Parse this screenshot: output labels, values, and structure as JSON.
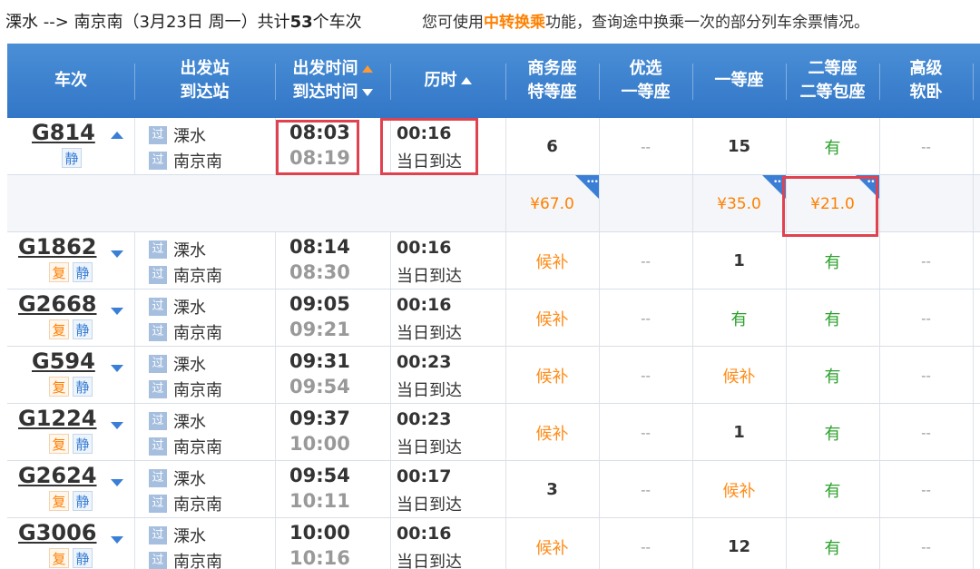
{
  "header": {
    "route_prefix": "溧水 --> 南京南（3月23日  周一）共计",
    "count": "53",
    "route_suffix": "个车次",
    "notice_prefix": "您可使用",
    "notice_link": "中转换乘",
    "notice_suffix": "功能，查询途中换乘一次的部分列车余票情况。"
  },
  "columns": {
    "train": "车次",
    "stations_1": "出发站",
    "stations_2": "到达站",
    "times_1": "出发时间",
    "times_2": "到达时间",
    "duration": "历时",
    "business_1": "商务座",
    "business_2": "特等座",
    "premium_1": "优选",
    "premium_2": "一等座",
    "first": "一等座",
    "second_1": "二等座",
    "second_2": "二等包座",
    "soft_1": "高级",
    "soft_2": "软卧"
  },
  "trains": [
    {
      "code": "G814",
      "fu": "",
      "jing": "静",
      "from_tag": "过",
      "from": "溧水",
      "to_tag": "过",
      "to": "南京南",
      "dep": "08:03",
      "arr": "08:19",
      "dur": "00:16",
      "arrday": "当日到达",
      "business": "6",
      "premium": "--",
      "first": "15",
      "second": "有",
      "soft": "--"
    },
    {
      "code": "G1862",
      "fu": "复",
      "jing": "静",
      "from_tag": "过",
      "from": "溧水",
      "to_tag": "过",
      "to": "南京南",
      "dep": "08:14",
      "arr": "08:30",
      "dur": "00:16",
      "arrday": "当日到达",
      "business": "候补",
      "premium": "--",
      "first": "1",
      "second": "有",
      "soft": "--"
    },
    {
      "code": "G2668",
      "fu": "复",
      "jing": "静",
      "from_tag": "过",
      "from": "溧水",
      "to_tag": "过",
      "to": "南京南",
      "dep": "09:05",
      "arr": "09:21",
      "dur": "00:16",
      "arrday": "当日到达",
      "business": "候补",
      "premium": "--",
      "first": "有",
      "second": "有",
      "soft": "--"
    },
    {
      "code": "G594",
      "fu": "复",
      "jing": "静",
      "from_tag": "过",
      "from": "溧水",
      "to_tag": "过",
      "to": "南京南",
      "dep": "09:31",
      "arr": "09:54",
      "dur": "00:23",
      "arrday": "当日到达",
      "business": "候补",
      "premium": "--",
      "first": "候补",
      "second": "有",
      "soft": "--"
    },
    {
      "code": "G1224",
      "fu": "复",
      "jing": "静",
      "from_tag": "过",
      "from": "溧水",
      "to_tag": "过",
      "to": "南京南",
      "dep": "09:37",
      "arr": "10:00",
      "dur": "00:23",
      "arrday": "当日到达",
      "business": "候补",
      "premium": "--",
      "first": "1",
      "second": "有",
      "soft": "--"
    },
    {
      "code": "G2624",
      "fu": "复",
      "jing": "静",
      "from_tag": "过",
      "from": "溧水",
      "to_tag": "过",
      "to": "南京南",
      "dep": "09:54",
      "arr": "10:11",
      "dur": "00:17",
      "arrday": "当日到达",
      "business": "3",
      "premium": "--",
      "first": "候补",
      "second": "有",
      "soft": "--"
    },
    {
      "code": "G3006",
      "fu": "复",
      "jing": "静",
      "from_tag": "过",
      "from": "溧水",
      "to_tag": "过",
      "to": "南京南",
      "dep": "10:00",
      "arr": "10:16",
      "dur": "00:16",
      "arrday": "当日到达",
      "business": "候补",
      "premium": "--",
      "first": "12",
      "second": "有",
      "soft": "--"
    }
  ],
  "prices": {
    "business": "¥67.0",
    "first": "¥35.0",
    "second": "¥21.0",
    "corner_glyph": "•••"
  },
  "colors": {
    "header_blue": "#3a7fd5",
    "highlight_red": "#e0424f",
    "available_green": "#2ca02c",
    "waitlist_orange": "#ff8c1a"
  }
}
